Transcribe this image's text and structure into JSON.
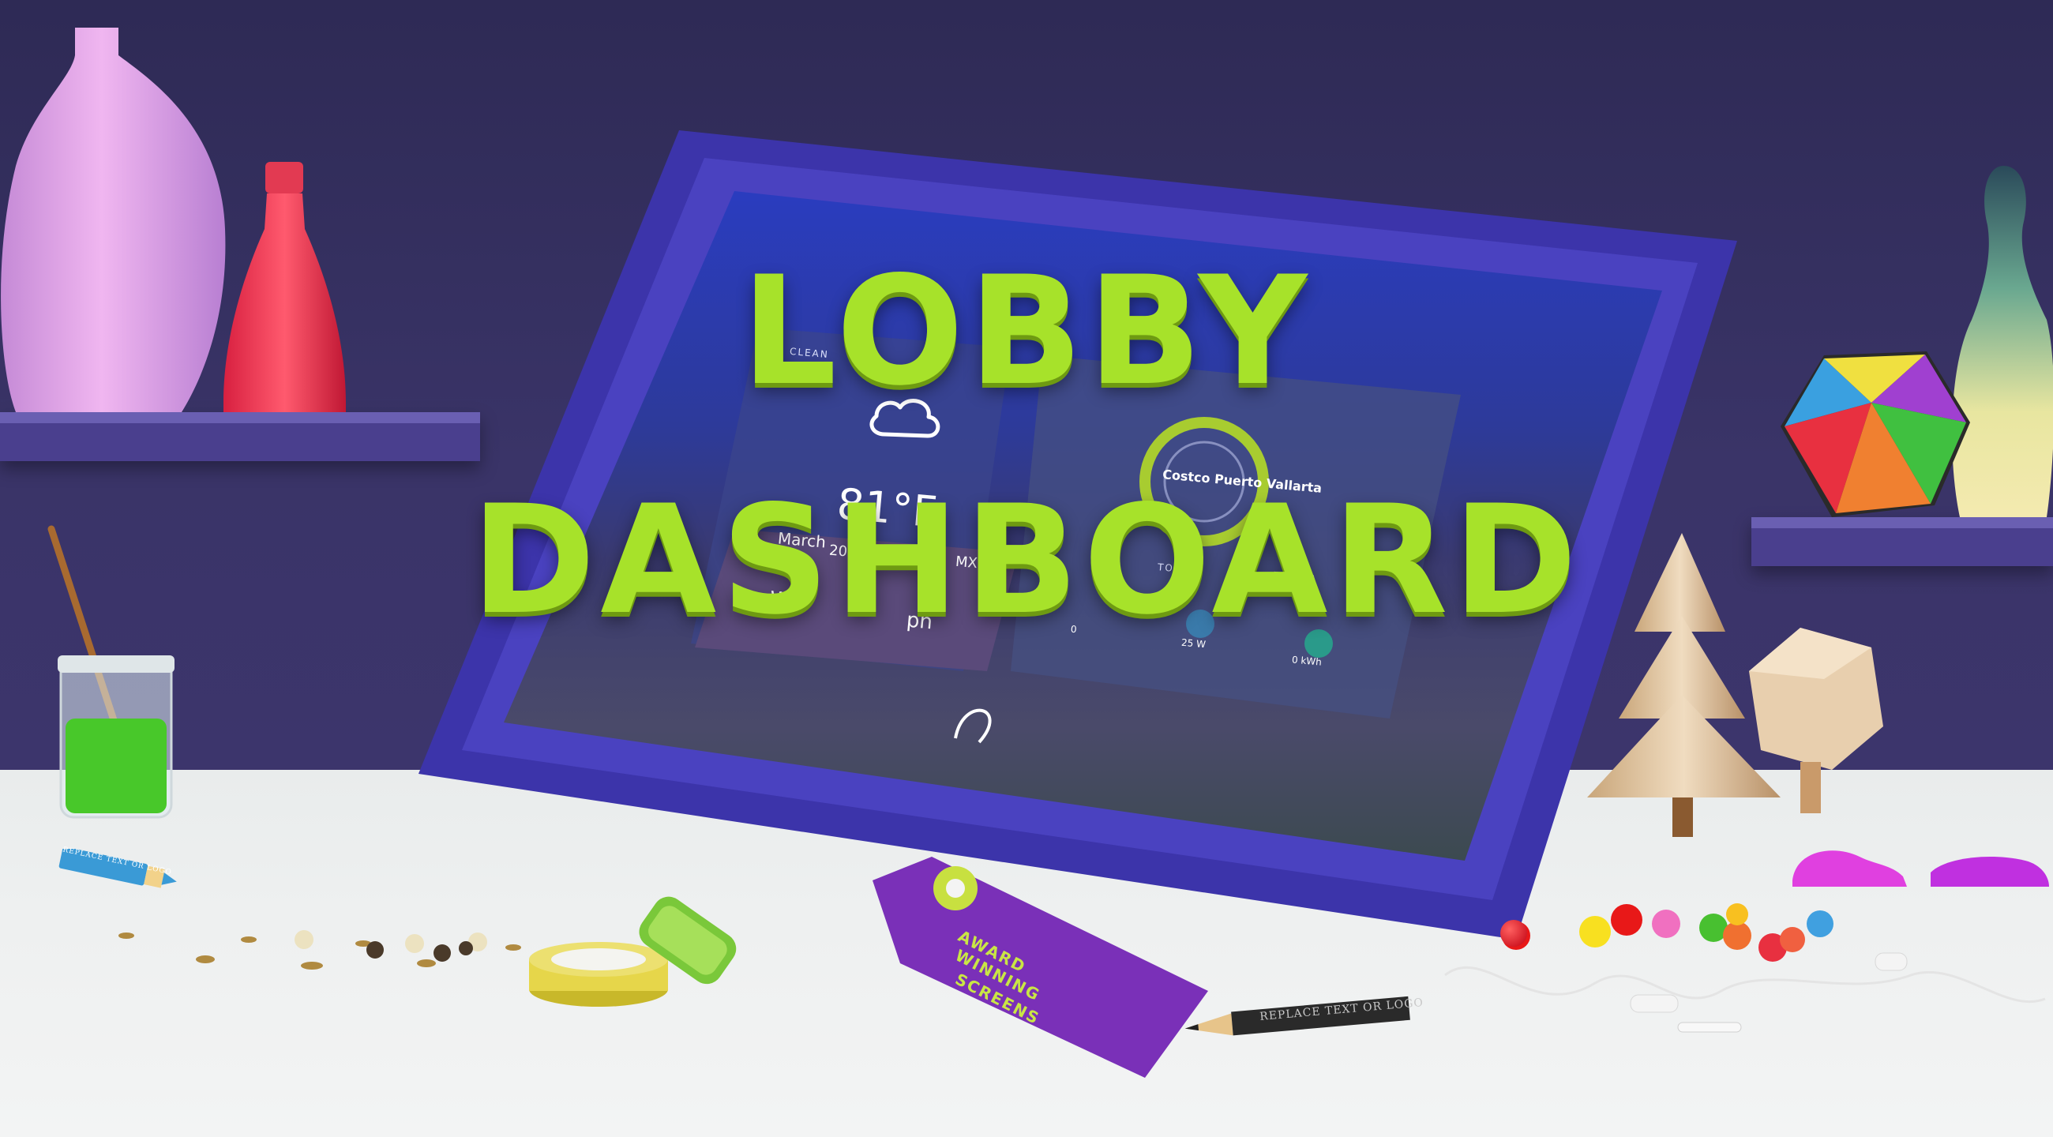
{
  "headline": {
    "line1": "LOBBY",
    "line2": "DASHBOARD"
  },
  "screen": {
    "label_clean": "CLEAN",
    "temperature": "81°F",
    "date_fragment": "March",
    "date_fragment2": "2015 - Ja",
    "date_fragment3": "MX",
    "letter_w": "W",
    "photo_fragment": "ph",
    "site_name": "Costco Puerto Vallarta",
    "power_label": "25 W",
    "energy_label": "0 kWh",
    "left_zero": "0",
    "to_label": "TO",
    "er_usa_label": "ER USA"
  },
  "tag": {
    "text_line1": "AWARD",
    "text_line2": "WINNING",
    "text_line3": "SCREENS"
  },
  "pencil": {
    "text": "REPLACE TEXT OR LOGO"
  },
  "marker": {
    "text": "REPLACE TEXT OR LOGO"
  },
  "colors": {
    "accent": "#a7e22a",
    "frame": "#3d35a8",
    "wall": "#2e2a55"
  }
}
